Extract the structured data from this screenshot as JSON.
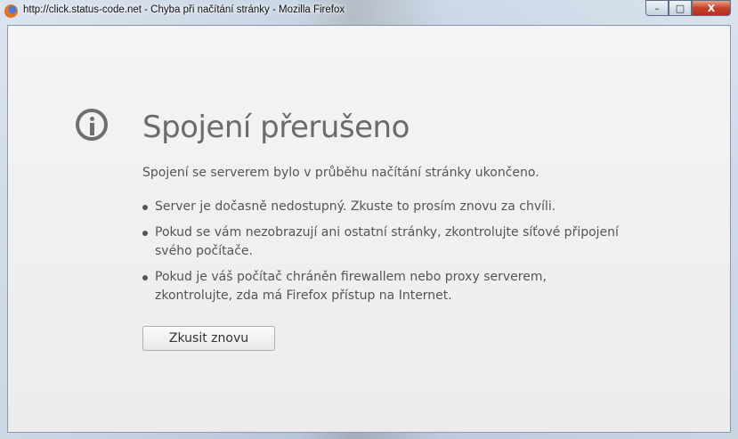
{
  "window": {
    "title": "http://click.status-code.net - Chyba při načítání stránky - Mozilla Firefox",
    "controls": {
      "minimize": "–",
      "maximize": "□",
      "close": "X"
    }
  },
  "error": {
    "title": "Spojení přerušeno",
    "description": "Spojení se serverem bylo v průběhu načítání stránky ukončeno.",
    "items": [
      "Server je dočasně nedostupný. Zkuste to prosím znovu za chvíli.",
      "Pokud se vám nezobrazují ani ostatní stránky, zkontrolujte síťové připojení svého počítače.",
      "Pokud je váš počítač chráněn firewallem nebo proxy serverem, zkontrolujte, zda má Firefox přístup na Internet."
    ],
    "retry_label": "Zkusit znovu"
  }
}
